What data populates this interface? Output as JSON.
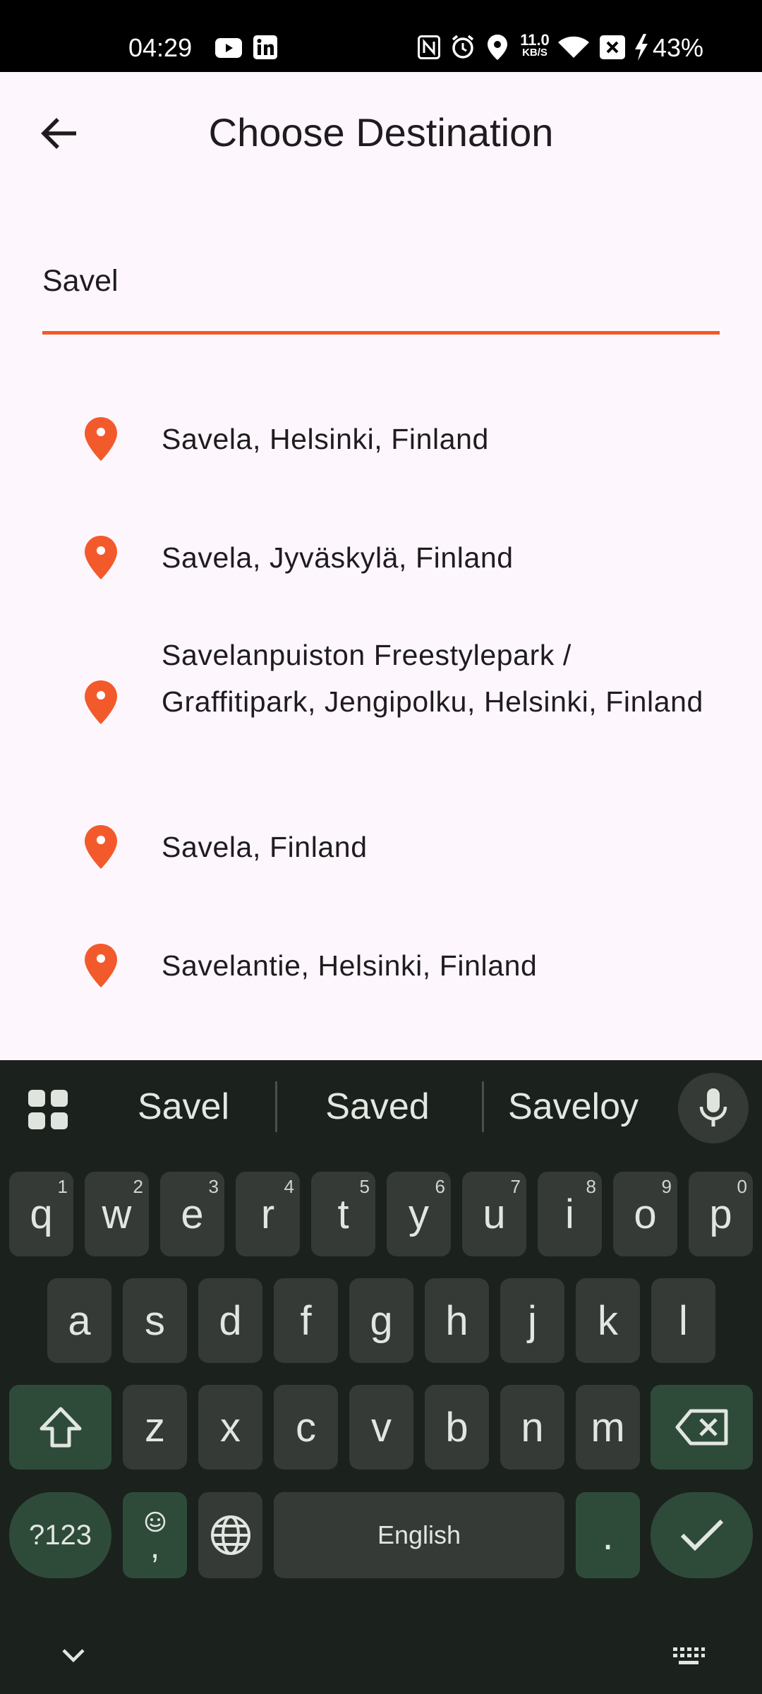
{
  "status_bar": {
    "time": "04:29",
    "net_speed_value": "11.0",
    "net_speed_unit": "KB/S",
    "battery": "43%"
  },
  "app_bar": {
    "title": "Choose Destination"
  },
  "search": {
    "value": "Savel"
  },
  "results": [
    {
      "label": "Savela, Helsinki, Finland"
    },
    {
      "label": "Savela, Jyväskylä, Finland"
    },
    {
      "label": "Savelanpuiston Freestylepark / Graffitipark, Jengipolku, Helsinki, Finland"
    },
    {
      "label": "Savela, Finland"
    },
    {
      "label": "Savelantie, Helsinki, Finland"
    }
  ],
  "keyboard": {
    "suggestions": [
      "Savel",
      "Saved",
      "Saveloy"
    ],
    "row1": [
      {
        "k": "q",
        "h": "1"
      },
      {
        "k": "w",
        "h": "2"
      },
      {
        "k": "e",
        "h": "3"
      },
      {
        "k": "r",
        "h": "4"
      },
      {
        "k": "t",
        "h": "5"
      },
      {
        "k": "y",
        "h": "6"
      },
      {
        "k": "u",
        "h": "7"
      },
      {
        "k": "i",
        "h": "8"
      },
      {
        "k": "o",
        "h": "9"
      },
      {
        "k": "p",
        "h": "0"
      }
    ],
    "row2": [
      "a",
      "s",
      "d",
      "f",
      "g",
      "h",
      "j",
      "k",
      "l"
    ],
    "row3": [
      "z",
      "x",
      "c",
      "v",
      "b",
      "n",
      "m"
    ],
    "symbols_label": "?123",
    "emoji_comma": ",",
    "space_label": "English",
    "period": "."
  },
  "colors": {
    "accent": "#f05a28",
    "background": "#fdf7fd",
    "keyboard_bg": "#1b211d"
  }
}
